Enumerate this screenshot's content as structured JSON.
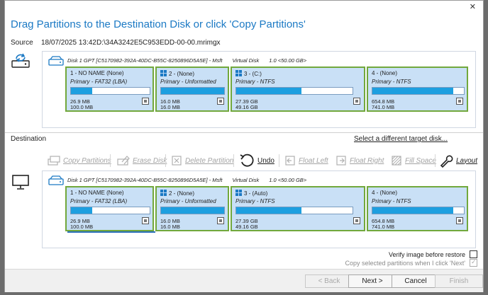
{
  "window": {
    "title": "Drag Partitions to the Destination Disk or click 'Copy Partitions'",
    "close": "✕"
  },
  "source": {
    "label": "Source",
    "date": "18/07/2025 13:42",
    "file": "D:\\34A3242E5C953EDD-00-00.mrimgx",
    "disk": {
      "name": "Disk 1 GPT [C5170982-392A-40DC-B55C-8250896D5A5E] - Msft",
      "kind": "Virtual Disk",
      "size": "1.0  <50.00 GB>",
      "partitions": [
        {
          "title": "1 - NO NAME (None)",
          "type": "Primary - FAT32 (LBA)",
          "used": "26.9 MB",
          "total": "100.0 MB",
          "fill": 0.27,
          "win": false
        },
        {
          "title": "2 - (None)",
          "type": "Primary - Unformatted",
          "used": "16.0 MB",
          "total": "16.0 MB",
          "fill": 1.0,
          "win": true
        },
        {
          "title": "3 - (C:)",
          "type": "Primary - NTFS",
          "used": "27.39 GB",
          "total": "49.16 GB",
          "fill": 0.56,
          "win": true
        },
        {
          "title": "4 - (None)",
          "type": "Primary - NTFS",
          "used": "654.8 MB",
          "total": "741.0 MB",
          "fill": 0.88,
          "win": false
        }
      ]
    }
  },
  "destination": {
    "label": "Destination",
    "target_link": "Select a different target disk...",
    "disk": {
      "name": "Disk 1 GPT [C5170982-392A-40DC-B55C-8250896D5A5E] - Msft",
      "kind": "Virtual Disk",
      "size": "1.0  <50.00 GB>",
      "partitions": [
        {
          "title": "1 - NO NAME (None)",
          "type": "Primary - FAT32 (LBA)",
          "used": "26.9 MB",
          "total": "100.0 MB",
          "fill": 0.27,
          "win": false
        },
        {
          "title": "2 - (None)",
          "type": "Primary - Unformatted",
          "used": "16.0 MB",
          "total": "16.0 MB",
          "fill": 1.0,
          "win": true
        },
        {
          "title": "3 - (Auto)",
          "type": "Primary - NTFS",
          "used": "27.39 GB",
          "total": "49.16 GB",
          "fill": 0.56,
          "win": true
        },
        {
          "title": "4 - (None)",
          "type": "Primary - NTFS",
          "used": "654.8 MB",
          "total": "741.0 MB",
          "fill": 0.88,
          "win": false
        }
      ]
    }
  },
  "toolbar": {
    "copy": "Copy Partitions",
    "erase": "Erase Disk",
    "delete": "Delete Partition",
    "undo": "Undo",
    "float_left": "Float Left",
    "float_right": "Float Right",
    "fill": "Fill Space",
    "layout": "Layout"
  },
  "options": {
    "verify": "Verify image before restore",
    "copy_next": "Copy selected partitions when I click 'Next'"
  },
  "footer": {
    "back": "< Back",
    "next": "Next >",
    "cancel": "Cancel",
    "finish": "Finish"
  },
  "colors": {
    "accent": "#1b79c4",
    "partition_bg": "#c9e0f6",
    "partition_border": "#72a83c",
    "bar_fill": "#1d9fe0"
  }
}
